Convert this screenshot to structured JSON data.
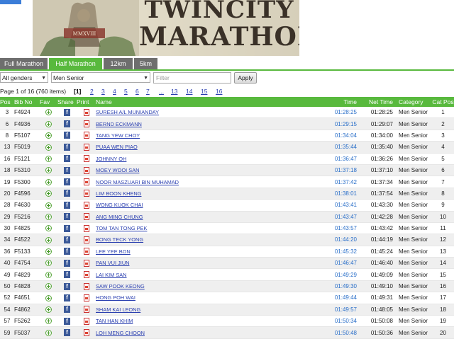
{
  "banner": {
    "title_line1": "TWINCITY",
    "title_line2": "MARATHON",
    "year": "MMXVIII"
  },
  "tabs": [
    {
      "label": "Full Marathon",
      "active": false
    },
    {
      "label": "Half Marathon",
      "active": true
    },
    {
      "label": "12km",
      "active": false
    },
    {
      "label": "5km",
      "active": false
    }
  ],
  "filters": {
    "gender": "All genders",
    "category": "Men Senior",
    "filter_placeholder": "Filter",
    "apply_label": "Apply"
  },
  "pager": {
    "summary": "Page 1 of 16 (760 items)",
    "current": "[1]",
    "pages": [
      "2",
      "3",
      "4",
      "5",
      "6",
      "7",
      "...",
      "13",
      "14",
      "15",
      "16"
    ]
  },
  "table": {
    "headers": [
      "Pos",
      "Bib No",
      "Fav",
      "Share",
      "Print",
      "Name",
      "Time",
      "Net Time",
      "Category",
      "Cat Pos"
    ],
    "rows": [
      {
        "pos": "3",
        "bib": "F4924",
        "name": "SURESH A/L MUNIANDAY",
        "time": "01:28:25",
        "net": "01:28:25",
        "cat": "Men Senior",
        "catpos": "1"
      },
      {
        "pos": "6",
        "bib": "F4936",
        "name": "BERND ECKMANN",
        "time": "01:29:15",
        "net": "01:29:07",
        "cat": "Men Senior",
        "catpos": "2"
      },
      {
        "pos": "8",
        "bib": "F5107",
        "name": "TANG YEW CHOY",
        "time": "01:34:04",
        "net": "01:34:00",
        "cat": "Men Senior",
        "catpos": "3"
      },
      {
        "pos": "13",
        "bib": "F5019",
        "name": "PUAA WEN PIAO",
        "time": "01:35:44",
        "net": "01:35:40",
        "cat": "Men Senior",
        "catpos": "4"
      },
      {
        "pos": "16",
        "bib": "F5121",
        "name": "JOHNNY OH",
        "time": "01:36:47",
        "net": "01:36:26",
        "cat": "Men Senior",
        "catpos": "5"
      },
      {
        "pos": "18",
        "bib": "F5310",
        "name": "MOEY WOOI SAN",
        "time": "01:37:18",
        "net": "01:37:10",
        "cat": "Men Senior",
        "catpos": "6"
      },
      {
        "pos": "19",
        "bib": "F5300",
        "name": "NOOR MASZUARI BIN MUHAMAD",
        "time": "01:37:42",
        "net": "01:37:34",
        "cat": "Men Senior",
        "catpos": "7"
      },
      {
        "pos": "20",
        "bib": "F4596",
        "name": "LIM BOON KHENG",
        "time": "01:38:01",
        "net": "01:37:54",
        "cat": "Men Senior",
        "catpos": "8"
      },
      {
        "pos": "28",
        "bib": "F4630",
        "name": "WONG KUOK CHAI",
        "time": "01:43:41",
        "net": "01:43:30",
        "cat": "Men Senior",
        "catpos": "9"
      },
      {
        "pos": "29",
        "bib": "F5216",
        "name": "ANG MING CHUNG",
        "time": "01:43:47",
        "net": "01:42:28",
        "cat": "Men Senior",
        "catpos": "10"
      },
      {
        "pos": "30",
        "bib": "F4825",
        "name": "TOM TAN TONG PEK",
        "time": "01:43:57",
        "net": "01:43:42",
        "cat": "Men Senior",
        "catpos": "11"
      },
      {
        "pos": "34",
        "bib": "F4522",
        "name": "BONG TECK YONG",
        "time": "01:44:20",
        "net": "01:44:19",
        "cat": "Men Senior",
        "catpos": "12"
      },
      {
        "pos": "36",
        "bib": "F5133",
        "name": "LEE YEE BON",
        "time": "01:45:32",
        "net": "01:45:24",
        "cat": "Men Senior",
        "catpos": "13"
      },
      {
        "pos": "40",
        "bib": "F4754",
        "name": "PAN VUI JIUN",
        "time": "01:46:47",
        "net": "01:46:40",
        "cat": "Men Senior",
        "catpos": "14"
      },
      {
        "pos": "49",
        "bib": "F4829",
        "name": "LAI KIM SAN",
        "time": "01:49:29",
        "net": "01:49:09",
        "cat": "Men Senior",
        "catpos": "15"
      },
      {
        "pos": "50",
        "bib": "F4828",
        "name": "SAW POOK KEONG",
        "time": "01:49:30",
        "net": "01:49:10",
        "cat": "Men Senior",
        "catpos": "16"
      },
      {
        "pos": "52",
        "bib": "F4651",
        "name": "HONG POH WAI",
        "time": "01:49:44",
        "net": "01:49:31",
        "cat": "Men Senior",
        "catpos": "17"
      },
      {
        "pos": "54",
        "bib": "F4862",
        "name": "SHAM KAI LEONG",
        "time": "01:49:57",
        "net": "01:48:05",
        "cat": "Men Senior",
        "catpos": "18"
      },
      {
        "pos": "57",
        "bib": "F5262",
        "name": "TAN HAN KHIM",
        "time": "01:50:34",
        "net": "01:50:08",
        "cat": "Men Senior",
        "catpos": "19"
      },
      {
        "pos": "59",
        "bib": "F5037",
        "name": "LOH MENG CHOON",
        "time": "01:50:48",
        "net": "01:50:36",
        "cat": "Men Senior",
        "catpos": "20"
      }
    ]
  }
}
